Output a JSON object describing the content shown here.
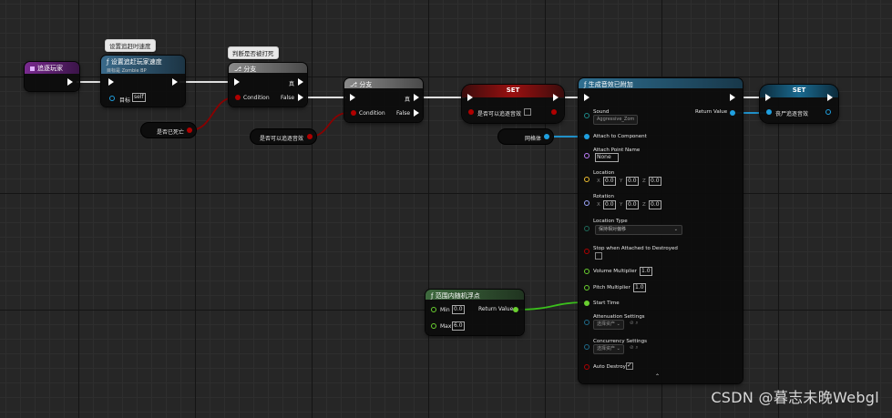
{
  "colors": {
    "exec": "#ffffff",
    "bool": "#8a0000",
    "object": "#1fa0e0",
    "float": "#6ad030",
    "name": "#c080ff",
    "vector": "#f0c030",
    "rotator": "#9fa8ff",
    "struct": "#1e6a8a"
  },
  "comments": {
    "speed": "设置追赶时速度",
    "judge": "判断是否被打死"
  },
  "event_node": {
    "title": "追逐玩家"
  },
  "set_speed": {
    "title": "设置追赶玩家速度",
    "subtitle": "目标是 Zombie BP",
    "target_label": "目标",
    "target_value": "self"
  },
  "branch1": {
    "title": "分支",
    "condition": "Condition",
    "true_label": "真",
    "false_label": "False"
  },
  "is_dead": {
    "label": "是否已死亡"
  },
  "branch2": {
    "title": "分支",
    "condition": "Condition",
    "true_label": "真",
    "false_label": "False"
  },
  "can_chase_get": {
    "label": "是否可以追逐音效"
  },
  "set1": {
    "title": "SET",
    "var_label": "是否可以追逐音效"
  },
  "mesh_get": {
    "label": "网格体"
  },
  "spawn_sound": {
    "title": "生成音效已附加",
    "sound_label": "Sound",
    "sound_value": "Aggressive_Zom",
    "return_label": "Return Value",
    "attach_label": "Attach to Component",
    "attach_point_label": "Attach Point Name",
    "attach_point_value": "None",
    "location_label": "Location",
    "loc_x": "0.0",
    "loc_y": "0.0",
    "loc_z": "0.0",
    "rotation_label": "Rotation",
    "rot_x": "0.0",
    "rot_y": "0.0",
    "rot_z": "0.0",
    "location_type_label": "Location Type",
    "location_type_value": "保持相对偏移",
    "stop_label": "Stop when Attached to Destroyed",
    "volume_label": "Volume Multiplier",
    "volume_value": "1.0",
    "pitch_label": "Pitch Multiplier",
    "pitch_value": "1.0",
    "start_label": "Start Time",
    "atten_label": "Attenuation Settings",
    "atten_value": "选择资产",
    "concur_label": "Concurrency Settings",
    "concur_value": "选择资产",
    "auto_destroy_label": "Auto Destroy"
  },
  "set2": {
    "title": "SET",
    "var_label": "丧尸追逐音效"
  },
  "random_float": {
    "title": "范围内随机浮点",
    "min_label": "Min",
    "min_value": "0.0",
    "max_label": "Max",
    "max_value": "6.0",
    "return_label": "Return Value"
  },
  "axis": {
    "x": "X",
    "y": "Y",
    "z": "Z"
  },
  "watermark": "CSDN @暮志未晚Webgl"
}
